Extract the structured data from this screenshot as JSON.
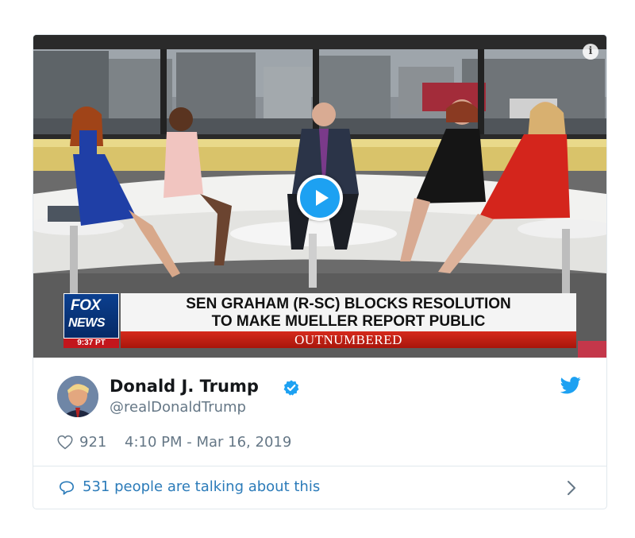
{
  "media": {
    "info_icon": "info-icon",
    "play_icon": "play-icon",
    "chyron": {
      "network_line1": "FOX",
      "network_line2": "NEWS",
      "time": "9:37 PT",
      "headline_line1": "SEN GRAHAM (R-SC) BLOCKS RESOLUTION",
      "headline_line2": "TO MAKE MUELLER REPORT PUBLIC",
      "show_name": "OUTNUMBERED"
    }
  },
  "tweet": {
    "display_name": "Donald J. Trump",
    "handle": "@realDonaldTrump",
    "verified": true,
    "like_count": "921",
    "timestamp": "4:10 PM - Mar 16, 2019",
    "conversation_text": "531 people are talking about this"
  },
  "icons": {
    "verified": "verified-badge-icon",
    "bird": "twitter-bird-icon",
    "like": "heart-icon",
    "reply": "comment-icon",
    "chevron": "chevron-right-icon"
  },
  "colors": {
    "twitter_blue": "#1da1f2",
    "link_blue": "#2b7bb9",
    "secondary_text": "#657786",
    "primary_text": "#14171a",
    "border": "#e1e8ed",
    "fox_red": "#c3161c",
    "fox_blue": "#0b3f8f"
  }
}
